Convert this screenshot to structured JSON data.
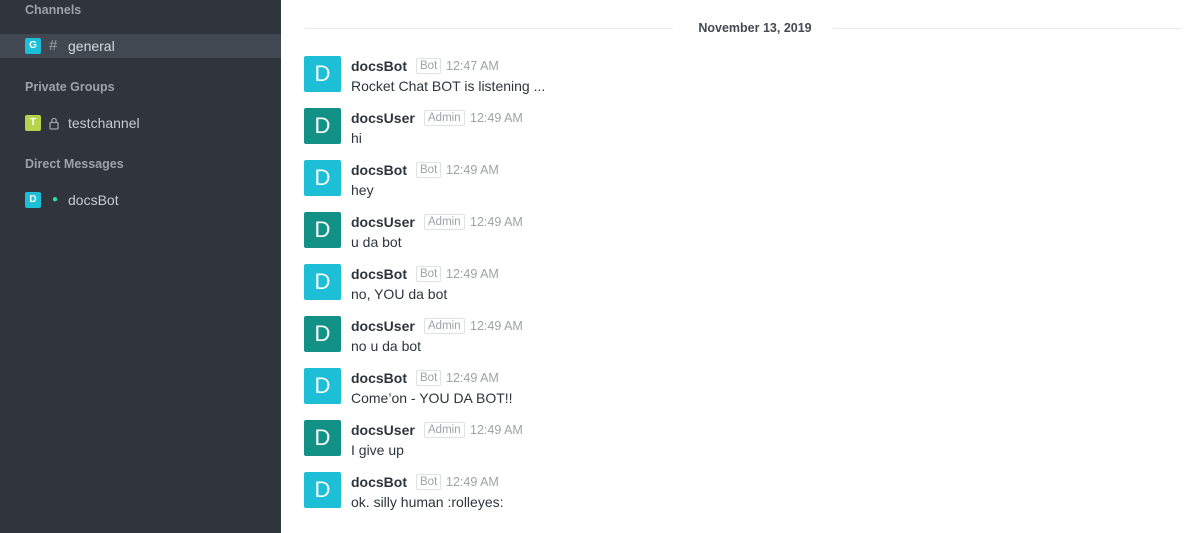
{
  "sidebar": {
    "channels_title": "Channels",
    "private_groups_title": "Private Groups",
    "direct_messages_title": "Direct Messages",
    "channels": [
      {
        "initial": "G",
        "glyph": "#",
        "name": "general",
        "color": "#1cbfd6",
        "active": true
      }
    ],
    "private_groups": [
      {
        "initial": "T",
        "glyph": "lock-icon",
        "name": "testchannel",
        "color": "#b7d24c"
      }
    ],
    "direct_messages": [
      {
        "initial": "D",
        "glyph": "online-status-icon",
        "name": "docsBot",
        "color": "#1cbfd6",
        "status_color": "#2de0a5"
      }
    ]
  },
  "chat": {
    "date_separator": "November 13, 2019",
    "messages": [
      {
        "avatar": "D",
        "author": "docsBot",
        "role": "Bot",
        "time": "12:47 AM",
        "text": "Rocket Chat BOT is listening ..."
      },
      {
        "avatar": "D",
        "author": "docsUser",
        "role": "Admin",
        "time": "12:49 AM",
        "text": "hi"
      },
      {
        "avatar": "D",
        "author": "docsBot",
        "role": "Bot",
        "time": "12:49 AM",
        "text": "hey"
      },
      {
        "avatar": "D",
        "author": "docsUser",
        "role": "Admin",
        "time": "12:49 AM",
        "text": "u da bot"
      },
      {
        "avatar": "D",
        "author": "docsBot",
        "role": "Bot",
        "time": "12:49 AM",
        "text": "no, YOU da bot"
      },
      {
        "avatar": "D",
        "author": "docsUser",
        "role": "Admin",
        "time": "12:49 AM",
        "text": "no u da bot"
      },
      {
        "avatar": "D",
        "author": "docsBot",
        "role": "Bot",
        "time": "12:49 AM",
        "text": "Come’on - YOU DA BOT!!"
      },
      {
        "avatar": "D",
        "author": "docsUser",
        "role": "Admin",
        "time": "12:49 AM",
        "text": "I give up"
      },
      {
        "avatar": "D",
        "author": "docsBot",
        "role": "Bot",
        "time": "12:49 AM",
        "text": "ok. silly human :rolleyes:"
      }
    ]
  },
  "colors": {
    "sidebar_bg": "#2f343d",
    "bot_avatar": "#1cbfd6",
    "user_avatar": "#129186",
    "online": "#2de0a5"
  }
}
